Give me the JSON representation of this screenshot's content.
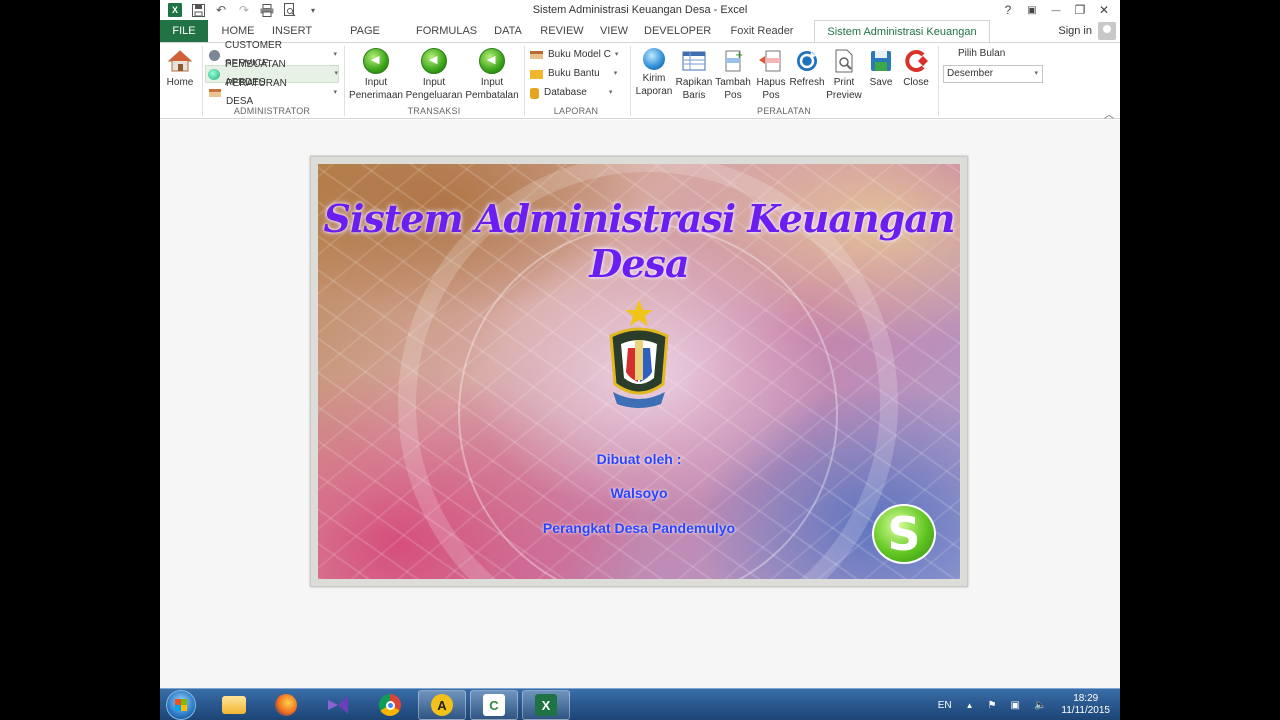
{
  "window": {
    "title": "Sistem Administrasi Keuangan Desa - Excel",
    "logo": "X",
    "controls": {
      "help": "?",
      "ribbon_options": "▣",
      "minimize": "—",
      "restore": "❐",
      "close": "✕"
    }
  },
  "quick_access": {
    "save": "💾",
    "undo": "↶",
    "redo": "↷",
    "customize": "▾"
  },
  "tabs": [
    {
      "label": "FILE"
    },
    {
      "label": "HOME"
    },
    {
      "label": "INSERT"
    },
    {
      "label": "PAGE LAYOUT"
    },
    {
      "label": "FORMULAS"
    },
    {
      "label": "DATA"
    },
    {
      "label": "REVIEW"
    },
    {
      "label": "VIEW"
    },
    {
      "label": "DEVELOPER"
    },
    {
      "label": "Foxit Reader PDF"
    },
    {
      "label": "Sistem Administrasi Keuangan Desa"
    }
  ],
  "account": {
    "sign_in": "Sign in"
  },
  "ribbon": {
    "home": {
      "label": "Home"
    },
    "administrator": {
      "label": "ADMINISTRATOR",
      "items": [
        {
          "label": "CUSTOMER SERVICE"
        },
        {
          "label": "PEMBUATAN APBDES"
        },
        {
          "label": "PERATURAN DESA"
        }
      ]
    },
    "transaksi": {
      "label": "TRANSAKSI",
      "buttons": [
        {
          "line1": "Input",
          "line2": "Penerimaan"
        },
        {
          "line1": "Input",
          "line2": "Pengeluaran"
        },
        {
          "line1": "Input",
          "line2": "Pembatalan"
        }
      ]
    },
    "laporan": {
      "label": "LAPORAN",
      "items": [
        {
          "label": "Buku Model C"
        },
        {
          "label": "Buku Bantu"
        },
        {
          "label": "Database"
        }
      ]
    },
    "peralatan": {
      "label": "PERALATAN",
      "buttons": [
        {
          "line1": "Kirim",
          "line2": "Laporan"
        },
        {
          "line1": "Rapikan",
          "line2": "Baris"
        },
        {
          "line1": "Tambah",
          "line2": "Pos"
        },
        {
          "line1": "Hapus",
          "line2": "Pos"
        },
        {
          "line1": "Refresh",
          "line2": ""
        },
        {
          "line1": "Print",
          "line2": "Preview"
        },
        {
          "line1": "Save",
          "line2": ""
        },
        {
          "line1": "Close",
          "line2": ""
        }
      ]
    },
    "month": {
      "label": "Pilih Bulan",
      "selected": "Desember"
    }
  },
  "splash": {
    "title": "Sistem Administrasi Keuangan Desa",
    "credit_label": "Dibuat oleh :",
    "author": "Walsoyo",
    "organization": "Perangkat Desa Pandemulyo",
    "skype_glyph": "S"
  },
  "taskbar": {
    "apps": [
      {
        "icon": "folder-icon"
      },
      {
        "icon": "firefox-icon"
      },
      {
        "icon": "visual-studio-icon"
      },
      {
        "icon": "chrome-icon"
      },
      {
        "icon": "app-a-icon",
        "glyph": "A"
      },
      {
        "icon": "camtasia-icon",
        "glyph": "C"
      },
      {
        "icon": "excel-icon",
        "glyph": "X"
      }
    ],
    "language": "EN",
    "time": "18:29",
    "date": "11/11/2015"
  }
}
